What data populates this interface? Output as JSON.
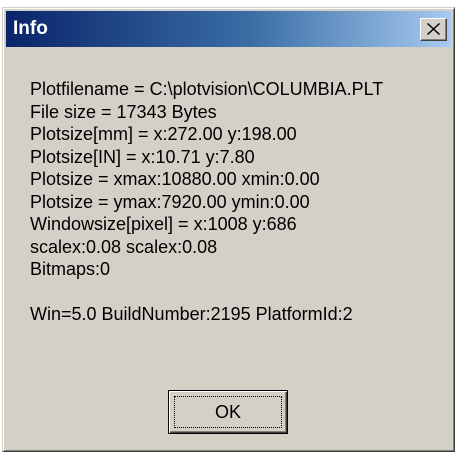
{
  "window": {
    "title": "Info",
    "close_icon": "close-icon"
  },
  "info": {
    "lines": [
      "Plotfilename = C:\\plotvision\\COLUMBIA.PLT",
      "File size  = 17343 Bytes",
      "Plotsize[mm] = x:272.00 y:198.00",
      "Plotsize[IN] = x:10.71 y:7.80",
      "Plotsize = xmax:10880.00 xmin:0.00",
      "Plotsize = ymax:7920.00 ymin:0.00",
      "Windowsize[pixel] = x:1008 y:686",
      "scalex:0.08 scalex:0.08",
      "Bitmaps:0"
    ],
    "version_line": "Win=5.0 BuildNumber:2195 PlatformId:2"
  },
  "buttons": {
    "ok_label": "OK"
  },
  "colors": {
    "titlebar_start": "#0a246a",
    "titlebar_end": "#a6caf0",
    "dialog_face": "#d4d0c8"
  }
}
